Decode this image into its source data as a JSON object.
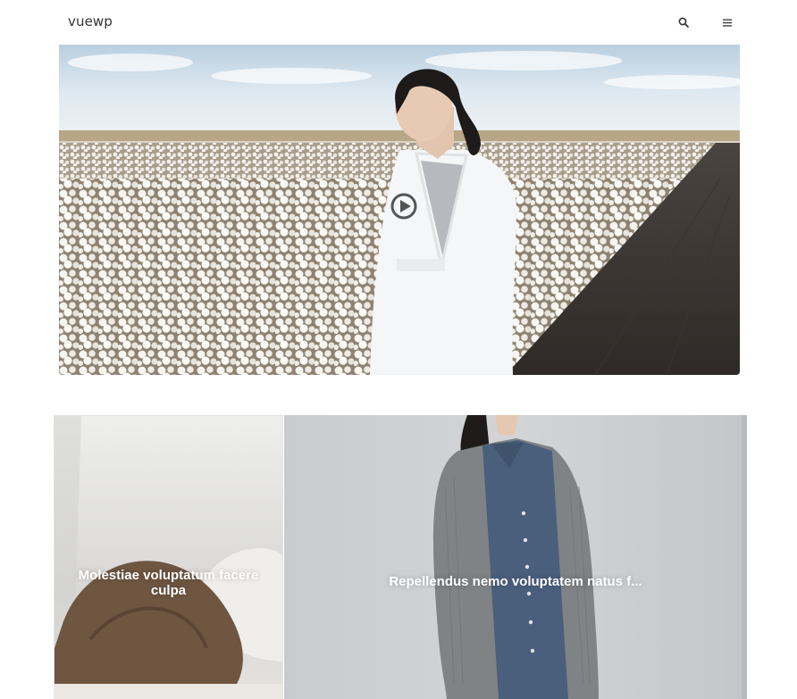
{
  "header": {
    "logo": "vuewp",
    "search_icon": "search-icon",
    "menu_icon": "hamburger-menu-icon"
  },
  "hero": {
    "play_icon": "play-circle-icon"
  },
  "cards": [
    {
      "title": "Molestiae voluptatum facere culpa"
    },
    {
      "title": "Repellendus nemo voluptatem natus f..."
    }
  ],
  "colors": {
    "background": "#ffffff",
    "logo_text": "#333333",
    "card_title": "#ffffff"
  }
}
